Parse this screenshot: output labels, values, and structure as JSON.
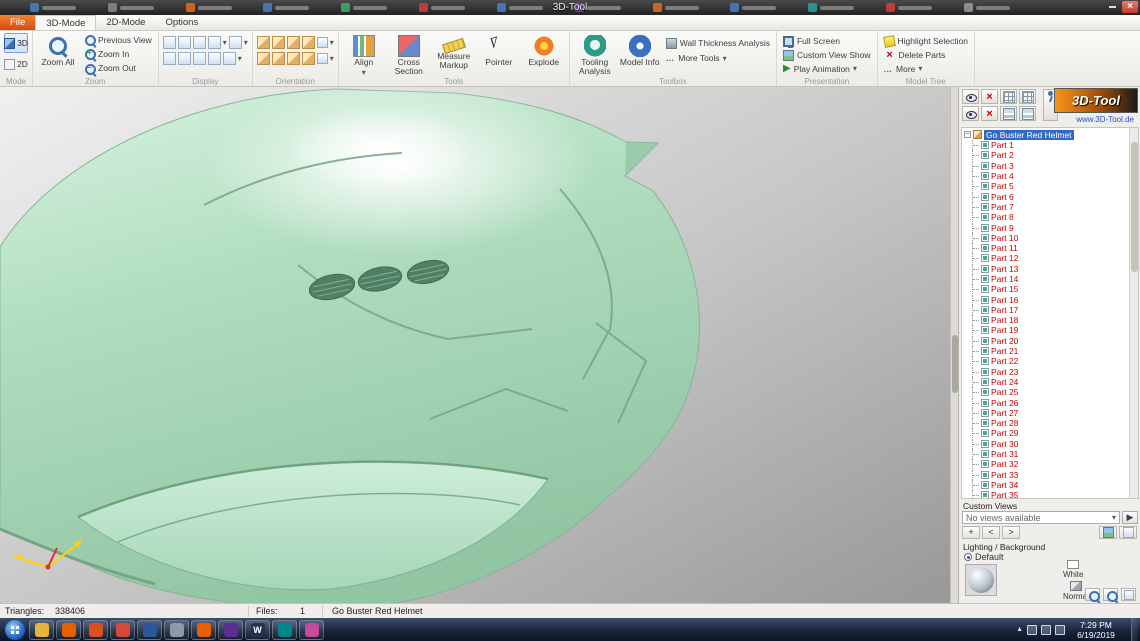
{
  "title_bar": {
    "title": "3D-Tool",
    "tabs": [
      {
        "color": "#4a7fbf"
      },
      {
        "color": "#8a8a8a"
      },
      {
        "color": "#e07020"
      },
      {
        "color": "#4a7fbf"
      },
      {
        "color": "#3fae6a"
      },
      {
        "color": "#d04040"
      },
      {
        "color": "#4a7fbf"
      },
      {
        "color": "#7a4fae"
      },
      {
        "color": "#e07020"
      },
      {
        "color": "#4a7fbf"
      },
      {
        "color": "#2aa0a0"
      },
      {
        "color": "#d04040"
      },
      {
        "color": "#9a9a9a"
      }
    ]
  },
  "menu": {
    "file": "File",
    "mode3d": "3D-Mode",
    "mode2d": "2D-Mode",
    "options": "Options"
  },
  "ribbon": {
    "mode": {
      "label": "Mode",
      "btn3d": "3D",
      "btn2d": "2D"
    },
    "zoom": {
      "label": "Zoom",
      "zoom_all": "Zoom All",
      "previous_view": "Previous View",
      "zoom_in": "Zoom In",
      "zoom_out": "Zoom Out"
    },
    "display": {
      "label": "Display"
    },
    "orientation": {
      "label": "Orientation"
    },
    "tools": {
      "label": "Tools",
      "align": "Align",
      "cross_section": "Cross Section",
      "measure_markup": "Measure Markup",
      "pointer": "Pointer",
      "explode": "Explode"
    },
    "toolbox": {
      "label": "Toolbox",
      "tooling_analysis": "Tooling Analysis",
      "model_info": "Model Info",
      "wall_thickness": "Wall Thickness Analysis",
      "more_tools": "More Tools"
    },
    "presentation": {
      "label": "Presentation",
      "full_screen": "Full Screen",
      "custom_view_show": "Custom View Show",
      "play_animation": "Play Animation"
    },
    "model_tree": {
      "label": "Model Tree",
      "highlight_selection": "Highlight Selection",
      "delete_parts": "Delete Parts",
      "more": "More"
    }
  },
  "model_tree": {
    "root": "Go Buster Red Helmet",
    "parts": [
      "Part 1",
      "Part 2",
      "Part 3",
      "Part 4",
      "Part 5",
      "Part 6",
      "Part 7",
      "Part 8",
      "Part 9",
      "Part 10",
      "Part 11",
      "Part 12",
      "Part 13",
      "Part 14",
      "Part 15",
      "Part 16",
      "Part 17",
      "Part 18",
      "Part 19",
      "Part 20",
      "Part 21",
      "Part 22",
      "Part 23",
      "Part 24",
      "Part 25",
      "Part 26",
      "Part 27",
      "Part 28",
      "Part 29",
      "Part 30",
      "Part 31",
      "Part 32",
      "Part 33",
      "Part 34",
      "Part 35"
    ]
  },
  "panel": {
    "logo_text": "3D-Tool",
    "logo_url": "www.3D-Tool.de",
    "custom_views": {
      "label": "Custom Views",
      "empty_text": "No views available"
    },
    "lighting": {
      "label": "Lighting / Background",
      "default_option": "Default",
      "white_label": "White",
      "normal_label": "Normal"
    }
  },
  "status_bar": {
    "triangles_label": "Triangles:",
    "triangles_value": "338406",
    "files_label": "Files:",
    "files_value": "1",
    "file_name": "Go Buster Red Helmet"
  },
  "taskbar": {
    "time": "7:29 PM",
    "date": "6/19/2019",
    "apps": [
      {
        "color": "#e8b33d",
        "label": ""
      },
      {
        "color": "#e66000",
        "label": ""
      },
      {
        "color": "#d94f20",
        "label": ""
      },
      {
        "color": "#d7483a",
        "label": ""
      },
      {
        "color": "#2b5797",
        "label": ""
      },
      {
        "color": "#8e9aa8",
        "label": ""
      },
      {
        "color": "#e66000",
        "label": ""
      },
      {
        "color": "#5c2d91",
        "label": ""
      },
      {
        "color": "#20324e",
        "label": "W"
      },
      {
        "color": "#00868a",
        "label": ""
      },
      {
        "color": "#c44a9a",
        "label": ""
      }
    ]
  },
  "icons": {
    "dropdown": "▾",
    "ellipsis": "…",
    "close": "×",
    "play": "▶",
    "plus": "+",
    "minus": "−",
    "prev": "<",
    "next": ">",
    "tray_up": "▲"
  },
  "colors": {
    "accent_orange": "#e8650d",
    "helmet_green": "#aedcbd",
    "selection_blue": "#316ac5",
    "part_text_red": "#cc0000"
  }
}
